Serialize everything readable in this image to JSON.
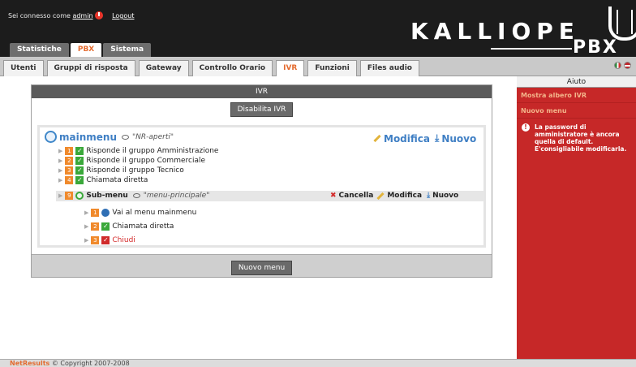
{
  "header": {
    "logged_in_as": "Sei connesso come",
    "username": "admin",
    "logout": "Logout",
    "brand": "KALLIOPE",
    "brand_sub": "PBX"
  },
  "main_tabs": [
    {
      "label": "Statistiche",
      "active": false
    },
    {
      "label": "PBX",
      "active": true
    },
    {
      "label": "Sistema",
      "active": false
    }
  ],
  "sub_tabs": [
    {
      "label": "Utenti",
      "active": false
    },
    {
      "label": "Gruppi di risposta",
      "active": false
    },
    {
      "label": "Gateway",
      "active": false
    },
    {
      "label": "Controllo Orario",
      "active": false
    },
    {
      "label": "IVR",
      "active": true
    },
    {
      "label": "Funzioni",
      "active": false
    },
    {
      "label": "Files audio",
      "active": false
    }
  ],
  "ivr": {
    "title": "IVR",
    "disable_button": "Disabilita IVR",
    "new_menu_button": "Nuovo menu",
    "root": {
      "name": "mainmenu",
      "note": "\"NR-aperti\"",
      "edit": "Modifica",
      "new": "Nuovo"
    },
    "options": [
      {
        "num": "1",
        "text": "Risponde il gruppo Amministrazione"
      },
      {
        "num": "2",
        "text": "Risponde il gruppo Commerciale"
      },
      {
        "num": "3",
        "text": "Risponde il gruppo Tecnico"
      },
      {
        "num": "4",
        "text": "Chiamata diretta"
      }
    ],
    "submenu": {
      "num": "9",
      "name": "Sub-menu",
      "note": "\"menu-principale\"",
      "delete": "Cancella",
      "edit": "Modifica",
      "new": "Nuovo",
      "options": [
        {
          "num": "1",
          "text": "Vai al menu mainmenu"
        },
        {
          "num": "2",
          "text": "Chiamata diretta"
        },
        {
          "num": "3",
          "text": "Chiudi"
        }
      ]
    }
  },
  "help": {
    "title": "Aiuto",
    "links": [
      "Mostra albero IVR",
      "Nuovo menu"
    ],
    "warning": "La password di amministratore è ancora quella di default. E'consigliabile modificarla."
  },
  "footer": {
    "brand": "NetResults",
    "copyright": "© Copyright 2007-2008"
  },
  "colors": {
    "accent": "#e46b2f",
    "help_bg": "#c62828",
    "header_bg": "#1c1c1c"
  }
}
